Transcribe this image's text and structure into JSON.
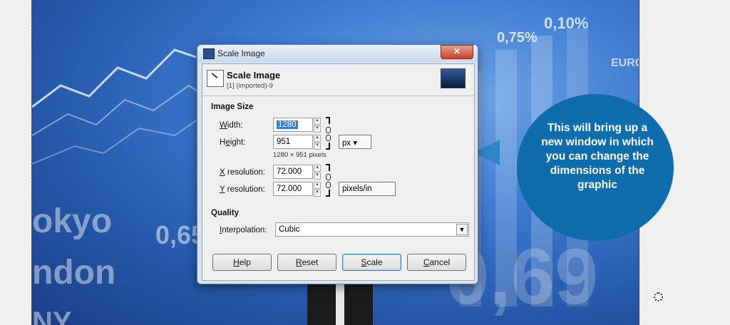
{
  "background": {
    "texts": [
      "okyo",
      "ndon",
      "NY",
      "0,65",
      "0,69",
      "0,75%",
      "0,10%",
      "EURO"
    ]
  },
  "dialog": {
    "window_title": "Scale Image",
    "close_label": "✕",
    "header_title": "Scale Image",
    "header_subtitle": "[1] (imported)-9",
    "image_size_heading": "Image Size",
    "width_label": "Width:",
    "width_value": "1280",
    "height_label": "Height:",
    "height_value": "951",
    "size_unit": "px",
    "pixel_summary": "1280 × 951 pixels",
    "xres_label": "X resolution:",
    "xres_value": "72.000",
    "yres_label": "Y resolution:",
    "yres_value": "72.000",
    "res_unit": "pixels/in",
    "quality_heading": "Quality",
    "interp_label": "Interpolation:",
    "interp_value": "Cubic",
    "buttons": {
      "help": "Help",
      "reset": "Reset",
      "scale": "Scale",
      "cancel": "Cancel"
    }
  },
  "callout": {
    "text": "This will bring up a new window in which you can change the dimensions of the graphic",
    "color": "#0f6cad"
  },
  "icons": [
    "gimp-window-icon",
    "scale-image-icon",
    "chain-link-icon",
    "dropdown-arrow-icon",
    "spin-arrows-icon",
    "selection-circle-icon"
  ]
}
